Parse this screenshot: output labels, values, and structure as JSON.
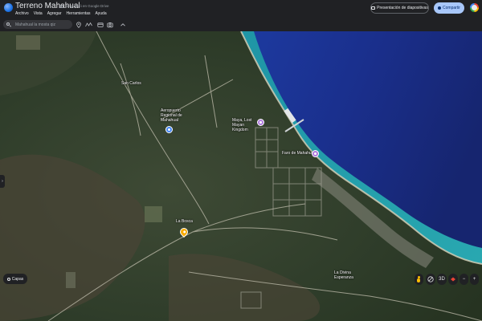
{
  "app": {
    "title": "Terreno Mahahual",
    "saved_status": "Se guardó en Google Drive",
    "menu": [
      "Archivo",
      "Vista",
      "Agregar",
      "Herramientas",
      "Ayuda"
    ],
    "present_label": "Presentación de diapositivas",
    "share_label": "Compartir"
  },
  "toolbar": {
    "search_placeholder": "Mahahual la mosta qiz",
    "tools": [
      "location-pin-icon",
      "path-icon",
      "card-icon",
      "camera-icon",
      "chevron-up-icon"
    ]
  },
  "map": {
    "places": {
      "san_carlos": "San Carlos",
      "aeropuerto": "Aeropuerto Regional de Mahahual",
      "maya_lost": "Maya, Lost Mayan Kingdom",
      "faro": "Faro de Mahahual",
      "la_bosca": "La Bosca",
      "la_divina": "La Divina Esperanza"
    },
    "layers_label": "Capas",
    "view_3d_label": "3D",
    "zoom_in": "+",
    "zoom_out": "−"
  },
  "colors": {
    "toolbar_bg": "#202124",
    "share_bg": "#a8c7fa",
    "ocean_deep": "#1a2f8c",
    "pin_orange": "#f9ab00",
    "pin_purple": "#b17ce0",
    "pin_blue": "#4285f4"
  }
}
